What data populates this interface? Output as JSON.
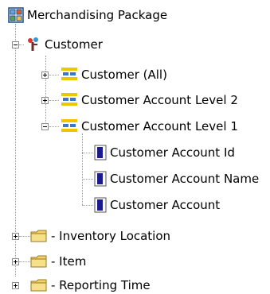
{
  "tree": {
    "root": {
      "label": "Merchandising Package",
      "icon": "package-icon"
    },
    "customer": {
      "label": "Customer",
      "icon": "dimension-icon"
    },
    "customer_all": {
      "label": "Customer (All)",
      "icon": "hierarchy-icon"
    },
    "account_level_2": {
      "label": "Customer Account Level 2",
      "icon": "hierarchy-icon"
    },
    "account_level_1": {
      "label": "Customer Account Level 1",
      "icon": "hierarchy-icon"
    },
    "account_id": {
      "label": "Customer Account Id",
      "icon": "attribute-icon"
    },
    "account_name": {
      "label": "Customer Account Name",
      "icon": "attribute-icon"
    },
    "account": {
      "label": "Customer Account",
      "icon": "attribute-icon"
    },
    "inventory_location": {
      "label": "- Inventory Location",
      "icon": "folder-icon"
    },
    "item": {
      "label": "- Item",
      "icon": "folder-icon"
    },
    "reporting_time": {
      "label": "- Reporting Time",
      "icon": "folder-icon"
    }
  },
  "colors": {
    "folder": "#f0d36a",
    "attribute": "#1b1b8f",
    "dimension": "#8b4b9c"
  }
}
